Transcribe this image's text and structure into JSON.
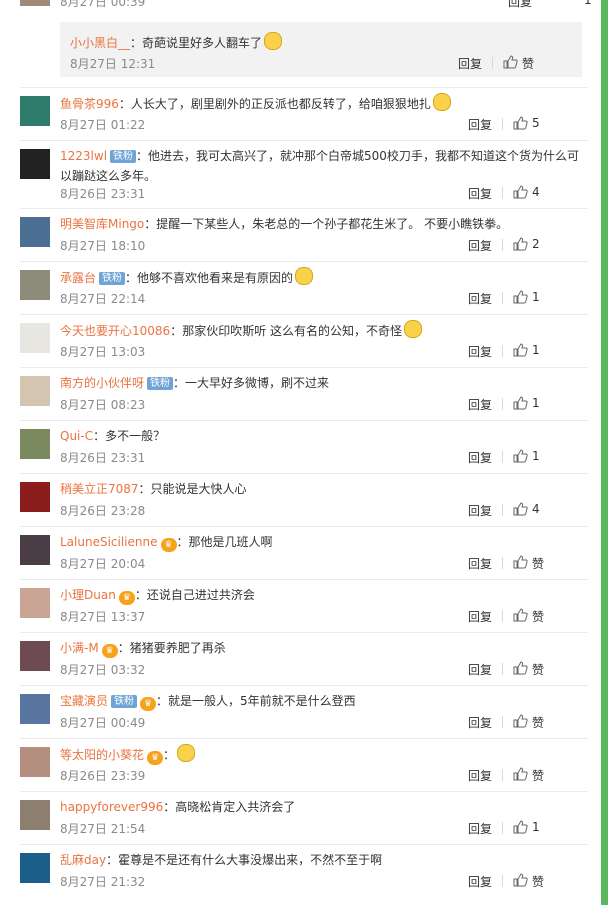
{
  "top_partial": {
    "date": "8月27日 00:39",
    "reply_label": "回复",
    "like_count": "1"
  },
  "reply": {
    "user": "小小黑白__",
    "text": "：奇葩说里好多人翻车了",
    "date": "8月27日 12:31",
    "reply_label": "回复",
    "like_label": "赞"
  },
  "comments": [
    {
      "user": "鱼骨茶996",
      "badge": "",
      "vip": false,
      "text": "：人长大了，剧里剧外的正反派也都反转了，给咱狠狠地扎",
      "emoji": true,
      "date": "8月27日 01:22",
      "reply_label": "回复",
      "like": "5"
    },
    {
      "user": "1223lwl",
      "badge": "铁粉",
      "vip": false,
      "text": "：他进去，我可太高兴了，就冲那个白帝城500校刀手，我都不知道这个货为什么可以蹦跶这么多年。",
      "emoji": false,
      "date": "8月26日 23:31",
      "reply_label": "回复",
      "like": "4"
    },
    {
      "user": "明美智库Mingo",
      "badge": "",
      "vip": false,
      "text": "：提醒一下某些人，朱老总的一个孙子都花生米了。 不要小瞧铁拳。",
      "emoji": false,
      "date": "8月27日 18:10",
      "reply_label": "回复",
      "like": "2"
    },
    {
      "user": "承露台",
      "badge": "铁粉",
      "vip": false,
      "text": "：他够不喜欢他看来是有原因的",
      "emoji": true,
      "date": "8月27日 22:14",
      "reply_label": "回复",
      "like": "1"
    },
    {
      "user": "今天也要开心10086",
      "badge": "",
      "vip": false,
      "text": "：那家伙印吹斯听 这么有名的公知，不奇怪",
      "emoji": true,
      "date": "8月27日 13:03",
      "reply_label": "回复",
      "like": "1"
    },
    {
      "user": "南方的小伙伴呀",
      "badge": "铁粉",
      "vip": false,
      "text": "：一大早好多微博，刷不过来",
      "emoji": false,
      "date": "8月27日 08:23",
      "reply_label": "回复",
      "like": "1"
    },
    {
      "user": "Qui-C",
      "badge": "",
      "vip": false,
      "text": "：多不一般？",
      "emoji": false,
      "date": "8月26日 23:31",
      "reply_label": "回复",
      "like": "1"
    },
    {
      "user": "稍美立正7087",
      "badge": "",
      "vip": false,
      "text": "：只能说是大快人心",
      "emoji": false,
      "date": "8月26日 23:28",
      "reply_label": "回复",
      "like": "4"
    },
    {
      "user": "LaluneSicilienne",
      "badge": "",
      "vip": true,
      "text": "：那他是几班人啊",
      "emoji": false,
      "date": "8月27日 20:04",
      "reply_label": "回复",
      "like": "赞"
    },
    {
      "user": "小理Duan",
      "badge": "",
      "vip": true,
      "text": "：还说自己进过共济会",
      "emoji": false,
      "date": "8月27日 13:37",
      "reply_label": "回复",
      "like": "赞"
    },
    {
      "user": "小满-M",
      "badge": "",
      "vip": true,
      "text": "：猪猪要养肥了再杀",
      "emoji": false,
      "date": "8月27日 03:32",
      "reply_label": "回复",
      "like": "赞"
    },
    {
      "user": "宝藏演员",
      "badge": "铁粉",
      "vip": true,
      "text": "：就是一般人，5年前就不是什么登西",
      "emoji": false,
      "date": "8月27日 00:49",
      "reply_label": "回复",
      "like": "赞"
    },
    {
      "user": "等太阳的小葵花",
      "badge": "",
      "vip": true,
      "text": "：",
      "emoji": true,
      "date": "8月26日 23:39",
      "reply_label": "回复",
      "like": "赞"
    },
    {
      "user": "happyforever996",
      "badge": "",
      "vip": false,
      "text": "：高晓松肯定入共济会了",
      "emoji": false,
      "date": "8月27日 21:54",
      "reply_label": "回复",
      "like": "1"
    },
    {
      "user": "乱麻day",
      "badge": "",
      "vip": false,
      "text": "：霍尊是不是还有什么大事没爆出来，不然不至于啊",
      "emoji": false,
      "date": "8月27日 21:32",
      "reply_label": "回复",
      "like": "赞"
    }
  ]
}
